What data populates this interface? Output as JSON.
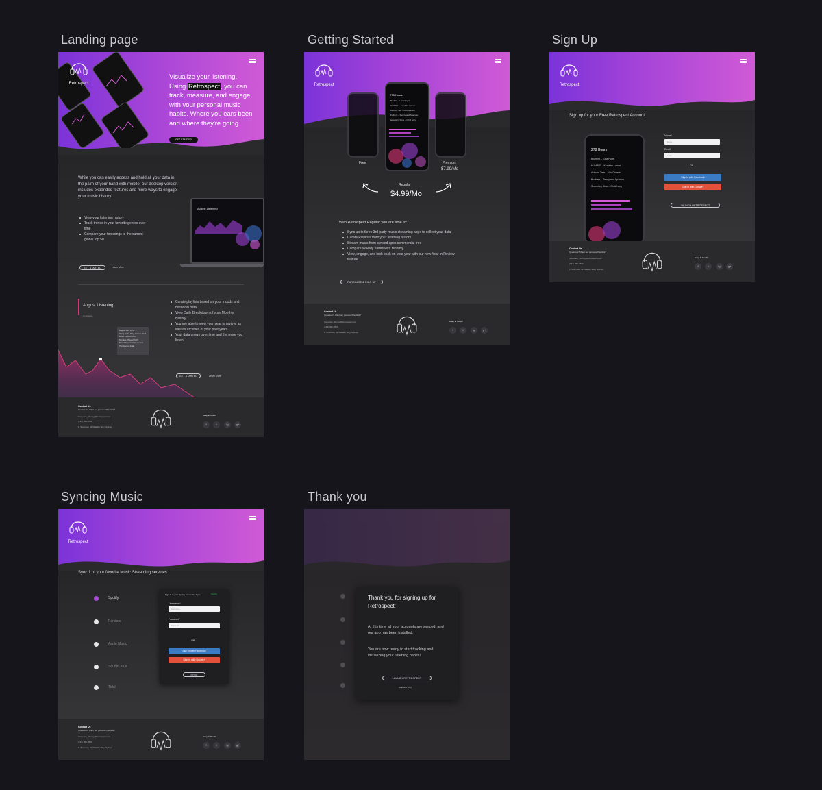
{
  "sections": {
    "landing": "Landing page",
    "getting_started": "Getting Started",
    "sign_up": "Sign Up",
    "syncing": "Syncing Music",
    "thank_you": "Thank you"
  },
  "brand": "Retrospect",
  "landing": {
    "hero_pre": "Visualize your listening.",
    "hero_using": "Using",
    "hero_brand": "Retrospect",
    "hero_post": ", you can track, measure, and engage with your personal music habits. Where you ears been and where they're going.",
    "hero_cta": "GET STARTED",
    "intro": "While you can easily access and hold all your data in the palm of your hand with mobile, our desktop version includes expanded features and more ways to engage your music history.",
    "bullets": [
      "View your listening history",
      "Track trends in your favorite genres over time",
      "Compare your top songs to the current global top 50"
    ],
    "cta_started": "GET STARTED",
    "cta_learn": "Learn More",
    "laptop_title": "August Listening",
    "chart_title": "August Listening",
    "chart_sub": "Consistent",
    "tooltip": "August 8th, 2017\nSong of the Day: Lemon Pool\nArtist: Lemon Pool\nMinutes Played: 9:03\nMost Played Artist: Lemon\nTop Genre: Indie",
    "bullets2": [
      "Curate playlists based on your moods and historical data",
      "View Daily Breakdown of your Monthly History",
      "You are able to view your year in review, as well as archives of your past years",
      "Your data grows over time and the more you listen."
    ],
    "cta2_started": "GET STARTED",
    "cta2_learn": "Learn More"
  },
  "footer": {
    "contact_title": "Contact Us",
    "contact_q": "Questions? Want our personal Playlists?",
    "email": "Someone_Jimmy@Retrospect.com",
    "phone": "(123) 456-7890",
    "address": "P. Sherman, 42 Wallaby Way, Sydney",
    "keep": "Keep in Touch!",
    "social": [
      "f",
      "t",
      "ig",
      "g+"
    ]
  },
  "getting_started": {
    "free": "Free",
    "regular": "Regular",
    "regular_price": "$4.99/Mo",
    "premium": "Premium",
    "premium_price": "$7.99/Mo",
    "phone_hours": "278 Hours",
    "phone_songs": [
      "Bluebird – Luca Fogel",
      "HUMBLE – Kendrick Lamar",
      "Autumn Tree – Milo Greene",
      "Brothers – Penny and Sparrow",
      "Sedentary Slow – Child Ivory"
    ],
    "able_title": "With Retrospect Regular you are able to:",
    "bullets": [
      "Sync up to three 3rd party-music streaming apps to collect your data",
      "Curate Playlists from your listening history",
      "Stream music from synced apps commercial free",
      "Compare Weekly habits with Monthly",
      "View, engage, and look back on your year with our new Year in Review feature"
    ],
    "cta": "PURCHASE & SIGN UP"
  },
  "sign_up": {
    "heading": "Sign up for your Free Retrospect Account",
    "name_label": "Name*",
    "name_ph": "Name",
    "email_label": "Email*",
    "email_ph": "Email",
    "or": "OR",
    "fb": "Sign in with Facebook",
    "google": "Sign in with Google+",
    "cta": "LAUNCH RETROSPECT"
  },
  "syncing": {
    "heading": "Sync 1 of your favorite Music Streaming services.",
    "services": [
      "Spotify",
      "Pandora",
      "Apple Music",
      "SoundCloud",
      "Tidal"
    ],
    "modal_title": "Sign in to your Spotify Account to Sync",
    "modal_brand": "Spotify",
    "user_label": "Username*",
    "user_ph": "Username",
    "pass_label": "Password*",
    "pass_ph": "Password",
    "or": "OR",
    "fb": "Sign in with Facebook",
    "google": "Sign in with Google+",
    "sync": "SYNC"
  },
  "thank_you": {
    "title": "Thank you for signing up for Retrospect!",
    "p1": "At this time all your accounts are synced, and our app has been installed.",
    "p2": "You are now ready to start tracking and visualizing your listening habits!",
    "cta": "LAUNCH RETROSPECT",
    "faq": "Help and FAQ"
  }
}
